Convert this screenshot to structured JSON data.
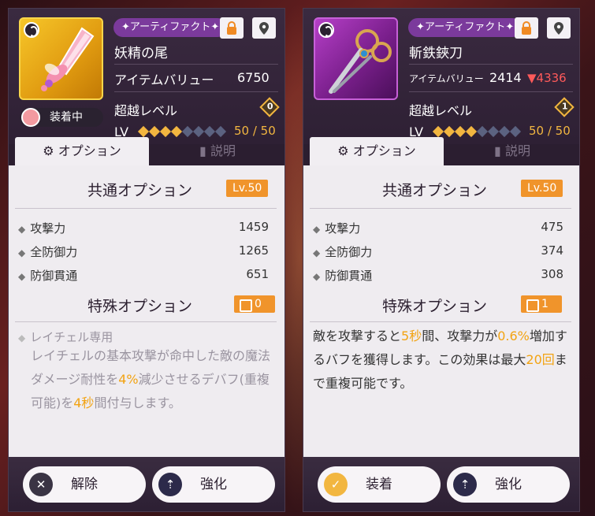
{
  "left": {
    "badge": "アーティファクト",
    "name": "妖精の尾",
    "value_label": "アイテムバリュー",
    "value": "6750",
    "rank_label": "超越レベル",
    "rank": "0",
    "lv_label": "LV",
    "lv_value": "50 / 50",
    "equipped_label": "装着中",
    "tabs": [
      "オプション",
      "説明"
    ],
    "common_title": "共通オプション",
    "common_lv": "Lv.50",
    "stats": [
      {
        "name": "攻撃力",
        "value": "1459"
      },
      {
        "name": "全防御力",
        "value": "1265"
      },
      {
        "name": "防御貫通",
        "value": "651"
      }
    ],
    "special_title": "特殊オプション",
    "special_count": "0",
    "special_item": "レイチェル専用",
    "desc_parts": [
      "レイチェルの基本攻撃が命中した敵の魔法ダメージ耐性を",
      "4%",
      "減少させるデバフ(重複可能)を",
      "4秒",
      "間付与します。"
    ],
    "buttons": [
      "解除",
      "強化"
    ]
  },
  "right": {
    "badge": "アーティファクト",
    "name": "斬鉄鋏刀",
    "value_label": "アイテムバリュー",
    "value": "2414",
    "value_diff": "4336",
    "rank_label": "超越レベル",
    "rank": "1",
    "lv_label": "LV",
    "lv_value": "50 / 50",
    "tabs": [
      "オプション",
      "説明"
    ],
    "common_title": "共通オプション",
    "common_lv": "Lv.50",
    "stats": [
      {
        "name": "攻撃力",
        "value": "475"
      },
      {
        "name": "全防御力",
        "value": "374"
      },
      {
        "name": "防御貫通",
        "value": "308"
      }
    ],
    "special_title": "特殊オプション",
    "special_count": "1",
    "desc_parts": [
      "敵を攻撃すると",
      "5秒",
      "間、攻撃力が",
      "0.6%",
      "増加するバフを獲得します。この効果は最大",
      "20回",
      "まで重複可能です。"
    ],
    "buttons": [
      "装着",
      "強化"
    ]
  }
}
